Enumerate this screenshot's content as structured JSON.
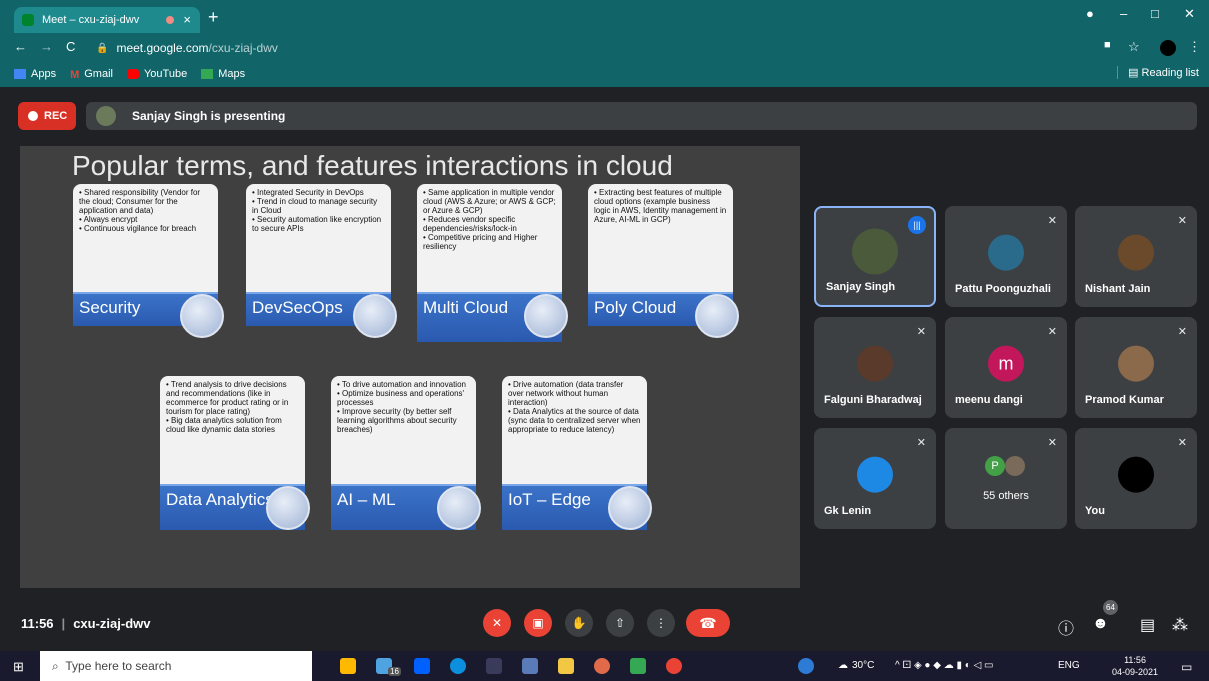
{
  "browser": {
    "tab_title": "Meet – cxu-ziaj-dwv",
    "url_domain": "meet.google.com",
    "url_path": "/cxu-ziaj-dwv",
    "bookmarks": [
      "Apps",
      "Gmail",
      "YouTube",
      "Maps"
    ],
    "reading_list": "Reading list"
  },
  "meet": {
    "rec_label": "REC",
    "presenting_text": "Sanjay Singh is presenting",
    "meeting_time": "11:56",
    "meeting_code": "cxu-ziaj-dwv",
    "participant_count": "64"
  },
  "slide": {
    "title": "Popular terms, and features interactions in cloud",
    "cards": [
      {
        "label": "Security",
        "bullets": [
          "Shared responsibility (Vendor for the cloud; Consumer for the application and data)",
          "Always encrypt",
          "Continuous vigilance for breach"
        ]
      },
      {
        "label": "DevSecOps",
        "bullets": [
          "Integrated Security in DevOps",
          "Trend in cloud to manage security in Cloud",
          "Security automation like encryption to secure APIs"
        ]
      },
      {
        "label": "Multi Cloud",
        "bullets": [
          "Same application in multiple vendor cloud (AWS & Azure; or AWS & GCP; or Azure & GCP)",
          "Reduces vendor specific dependencies/risks/lock-in",
          "Competitive pricing  and Higher resiliency"
        ]
      },
      {
        "label": "Poly Cloud",
        "bullets": [
          "Extracting best features of multiple cloud options (example business logic in AWS, Identity management in Azure, AI-ML in GCP)"
        ]
      },
      {
        "label": "Data Analytics",
        "bullets": [
          "Trend analysis to drive decisions and recommendations (like in ecommerce for product rating or in tourism for place rating)",
          "Big data analytics solution from cloud like dynamic data stories"
        ]
      },
      {
        "label": "AI – ML",
        "bullets": [
          "To drive automation and innovation",
          "Optimize business and operations' processes",
          "Improve security (by better self learning algorithms about security breaches)"
        ]
      },
      {
        "label": "IoT – Edge",
        "bullets": [
          "Drive automation (data transfer over network without human interaction)",
          "Data Analytics  at the source of data (sync data to centralized server when appropriate to reduce latency)"
        ]
      }
    ]
  },
  "participants": [
    {
      "name": "Sanjay Singh",
      "avatar_color": "#4a5a3a",
      "active": true
    },
    {
      "name": "Pattu Poonguzhali",
      "avatar_color": "#2a6a8a"
    },
    {
      "name": "Nishant Jain",
      "avatar_color": "#6a4a2a"
    },
    {
      "name": "Falguni Bharadwaj",
      "avatar_color": "#5a3a2a"
    },
    {
      "name": "meenu dangi",
      "avatar_color": "#c2185b",
      "initial": "m"
    },
    {
      "name": "Pramod Kumar",
      "avatar_color": "#8a6a4a"
    },
    {
      "name": "Gk Lenin",
      "avatar_color": "#1e88e5"
    },
    {
      "name": "55 others",
      "avatar_color": "#43a047",
      "initial": "P"
    },
    {
      "name": "You",
      "avatar_color": "#000000"
    }
  ],
  "taskbar": {
    "search_placeholder": "Type here to search",
    "temperature": "30°C",
    "language": "ENG",
    "time": "11:56",
    "date": "04-09-2021",
    "badge": "16"
  }
}
